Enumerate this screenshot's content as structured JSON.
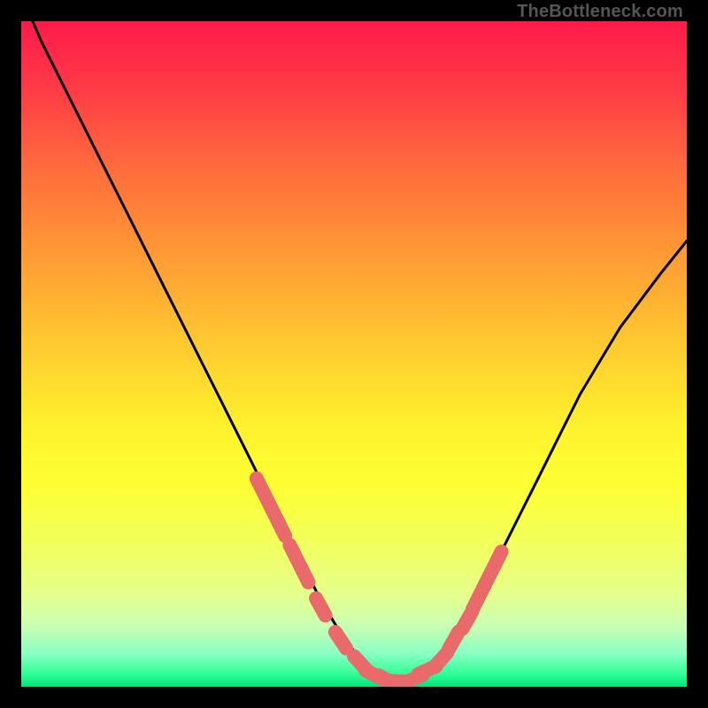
{
  "watermark": "TheBottleneck.com",
  "chart_data": {
    "type": "line",
    "title": "",
    "xlabel": "",
    "ylabel": "",
    "xlim": [
      0,
      100
    ],
    "ylim": [
      0,
      100
    ],
    "grid": false,
    "series": [
      {
        "name": "bottleneck-curve",
        "x": [
          0,
          3,
          6,
          9,
          12,
          15,
          18,
          21,
          24,
          27,
          30,
          33,
          36,
          39,
          42,
          45,
          48,
          51,
          54,
          57,
          60,
          63,
          66,
          69,
          72,
          75,
          78,
          81,
          84,
          87,
          90,
          93,
          96,
          100
        ],
        "y": [
          104,
          97,
          91,
          85,
          79,
          73,
          67,
          61,
          55,
          49,
          43,
          37,
          31,
          25,
          19,
          13,
          8,
          4,
          1.5,
          0.8,
          1.3,
          3.5,
          8,
          14,
          20,
          26,
          32,
          38,
          44,
          49,
          54,
          58,
          62,
          67
        ]
      }
    ],
    "markers": {
      "name": "highlighted-points",
      "x": [
        36,
        37.5,
        39,
        41,
        42.5,
        45,
        48,
        51,
        53,
        55,
        57,
        59,
        61,
        63,
        65,
        67,
        68.5,
        70,
        71.5
      ],
      "y": [
        30,
        27,
        24,
        20,
        17,
        12,
        7,
        3.5,
        1.8,
        1,
        0.8,
        1.2,
        2.5,
        4,
        7,
        10,
        13,
        16,
        19
      ]
    },
    "background_gradient": [
      "#ff1a4b",
      "#ffd52f",
      "#00e57a"
    ]
  }
}
